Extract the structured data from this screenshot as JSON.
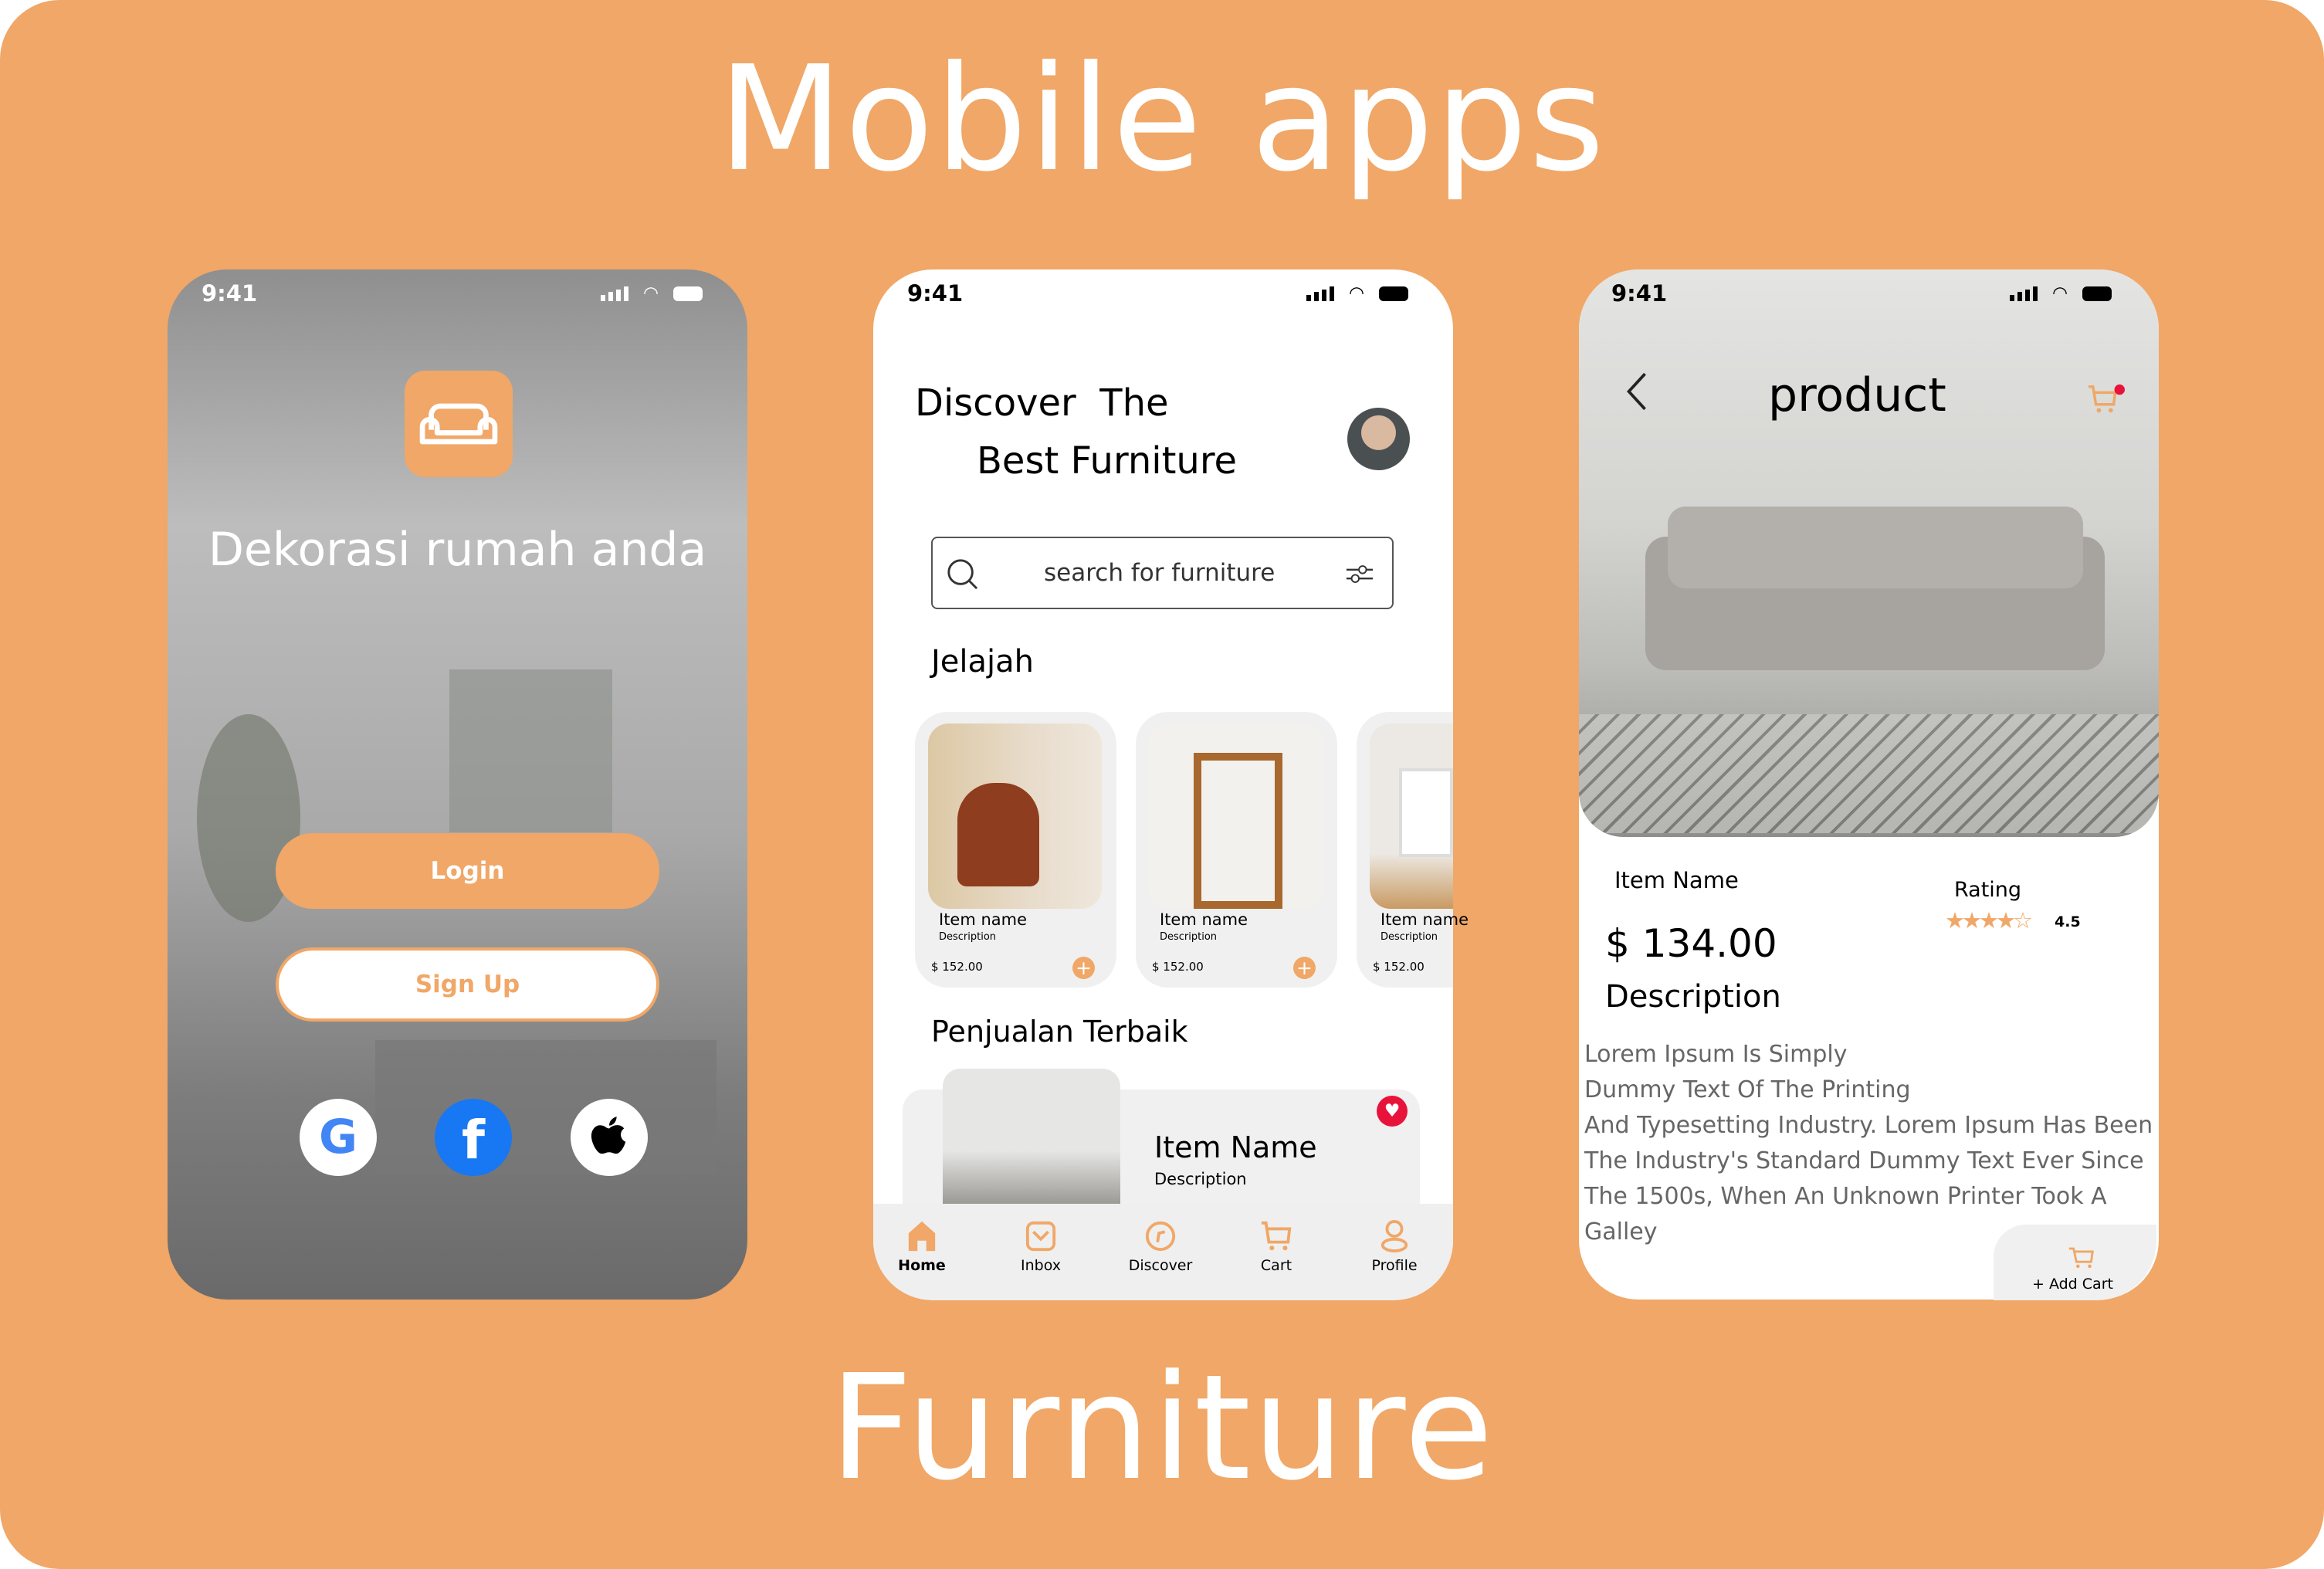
{
  "headline": "Mobile apps",
  "footer": "Furniture",
  "colors": {
    "accent": "#f0a767",
    "heart": "#e8133a",
    "card_bg": "#f0f0f0"
  },
  "status_time": "9:41",
  "login_screen": {
    "tagline": "Dekorasi rumah anda",
    "login": "Login",
    "signup": "Sign Up",
    "socials": [
      "google-icon",
      "facebook-icon",
      "apple-icon"
    ]
  },
  "home_screen": {
    "title_line1": "Discover  The",
    "title_line2": "Best Furniture",
    "search_placeholder": "search for furniture",
    "explore": "Jelajah",
    "cards": [
      {
        "name": "Item name",
        "desc": "Description",
        "price": "$ 152.00"
      },
      {
        "name": "Item name",
        "desc": "Description",
        "price": "$ 152.00"
      },
      {
        "name": "Item name",
        "desc": "Description",
        "price": "$ 152.00"
      }
    ],
    "best_selling": "Penjualan Terbaik",
    "best_item": {
      "name": "Item Name",
      "desc": "Description"
    },
    "nav": [
      {
        "label": "Home",
        "icon": "home-icon",
        "active": true
      },
      {
        "label": "Inbox",
        "icon": "inbox-icon"
      },
      {
        "label": "Discover",
        "icon": "compass-icon"
      },
      {
        "label": "Cart",
        "icon": "cart-icon"
      },
      {
        "label": "Profile",
        "icon": "profile-icon"
      }
    ]
  },
  "product_screen": {
    "title": "product",
    "item_name": "Item Name",
    "rating_label": "Rating",
    "rating": "4.5",
    "rating_value": 4.5,
    "price": "$ 134.00",
    "description_title": "Description",
    "description_lines": [
      "Lorem Ipsum Is Simply",
      "Dummy Text Of The Printing",
      "And Typesetting Industry. Lorem Ipsum Has Been",
      "The Industry's Standard Dummy Text Ever Since",
      "The 1500s, When An Unknown Printer Took A",
      "Galley"
    ],
    "add_cart": "+ Add Cart"
  }
}
